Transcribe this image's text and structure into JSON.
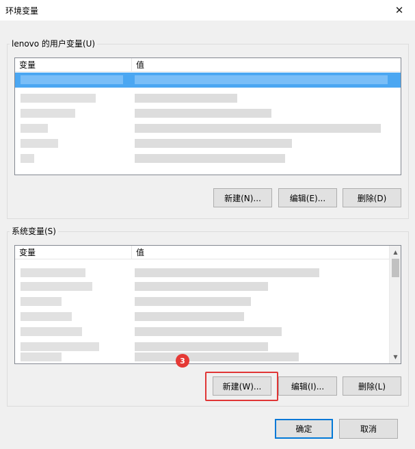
{
  "window": {
    "title": "环境变量",
    "close_glyph": "✕"
  },
  "user_group": {
    "legend": "lenovo 的用户变量(U)",
    "columns": [
      "变量",
      "值"
    ],
    "buttons": {
      "new": "新建(N)...",
      "edit": "编辑(E)...",
      "delete": "删除(D)"
    }
  },
  "system_group": {
    "legend": "系统变量(S)",
    "columns": [
      "变量",
      "值"
    ],
    "buttons": {
      "new": "新建(W)...",
      "edit": "编辑(I)...",
      "delete": "删除(L)"
    }
  },
  "dialog_buttons": {
    "ok": "确定",
    "cancel": "取消"
  },
  "annotation": {
    "step_number": "3",
    "color": "#e53935"
  },
  "colors": {
    "selection": "#4ba7f2",
    "default_button_border": "#0078d7",
    "highlight_box": "#e03535"
  },
  "icons": {
    "close": "close-icon",
    "scroll_up": "chevron-up-icon",
    "scroll_down": "chevron-down-icon"
  }
}
